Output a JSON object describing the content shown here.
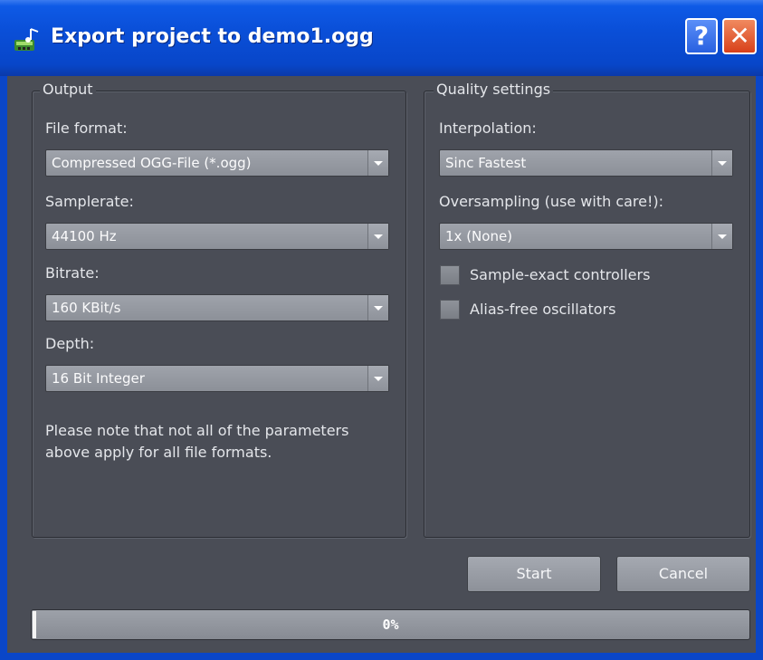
{
  "window": {
    "title": "Export project to demo1.ogg",
    "help_glyph": "?",
    "close_glyph": "✕"
  },
  "output": {
    "group_title": "Output",
    "file_format": {
      "label": "File format:",
      "value": "Compressed OGG-File (*.ogg)"
    },
    "samplerate": {
      "label": "Samplerate:",
      "value": "44100 Hz"
    },
    "bitrate": {
      "label": "Bitrate:",
      "value": "160 KBit/s"
    },
    "depth": {
      "label": "Depth:",
      "value": "16 Bit Integer"
    },
    "note_line1": "Please note that not all of the parameters",
    "note_line2": "above apply for all file formats."
  },
  "quality": {
    "group_title": "Quality settings",
    "interpolation": {
      "label": "Interpolation:",
      "value": "Sinc Fastest"
    },
    "oversampling": {
      "label": "Oversampling (use with care!):",
      "value": "1x (None)"
    },
    "sample_exact": {
      "label": "Sample-exact controllers",
      "checked": false
    },
    "alias_free": {
      "label": "Alias-free oscillators",
      "checked": false
    }
  },
  "buttons": {
    "start": "Start",
    "cancel": "Cancel"
  },
  "progress": {
    "value": 0,
    "text": "0%"
  }
}
